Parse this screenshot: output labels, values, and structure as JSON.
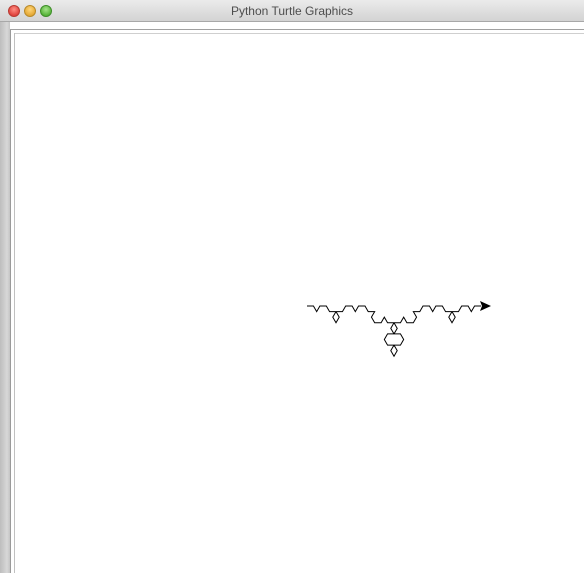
{
  "window": {
    "title": "Python Turtle Graphics",
    "controls": [
      "close",
      "minimize",
      "zoom"
    ]
  },
  "canvas": {
    "background": "#ffffff",
    "curve": {
      "kind": "koch-curve",
      "order": 3,
      "stroke": "#000000"
    },
    "turtle": {
      "shape": "classic-arrow",
      "color": "#000000",
      "heading": "east"
    }
  }
}
